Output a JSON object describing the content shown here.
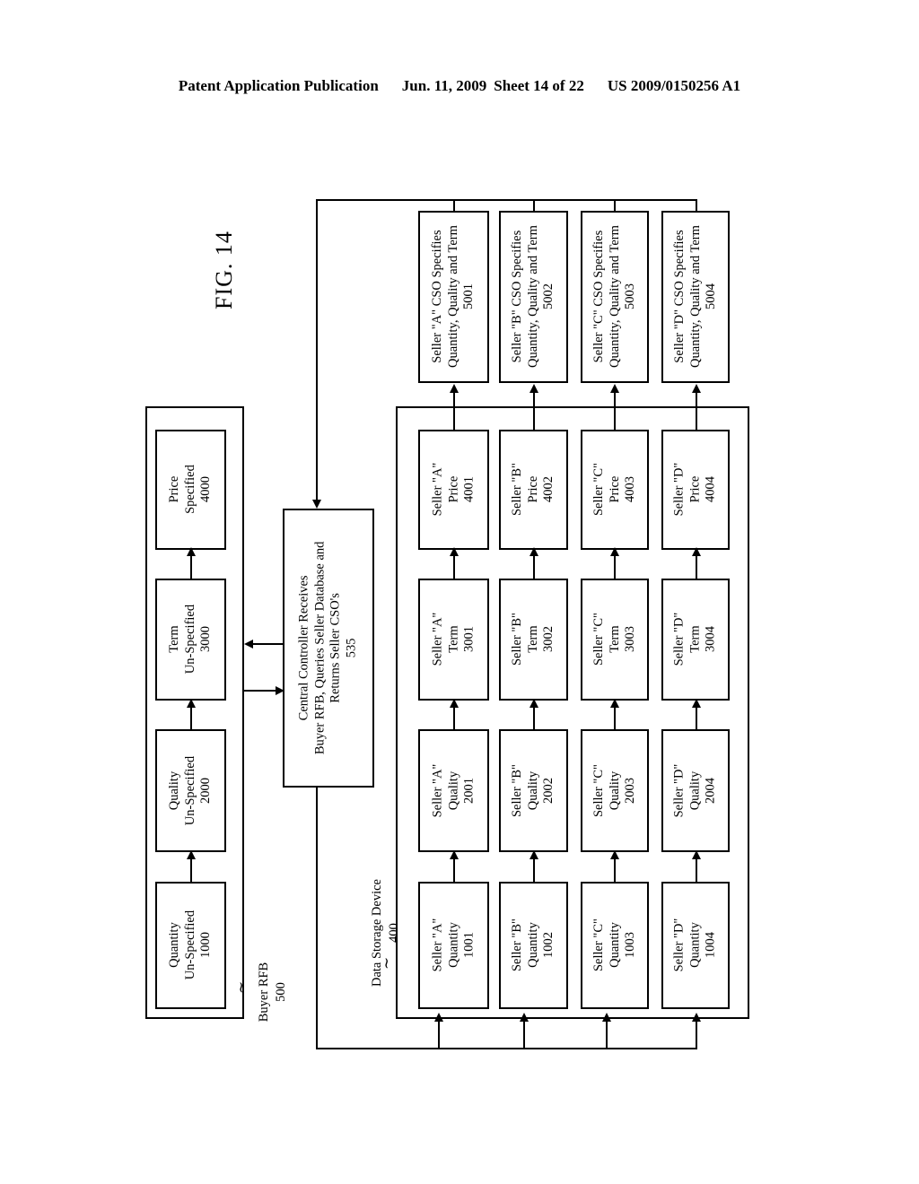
{
  "header": {
    "publication": "Patent Application Publication",
    "date": "Jun. 11, 2009",
    "sheet": "Sheet 14 of 22",
    "patent_number": "US 2009/0150256 A1"
  },
  "figure": {
    "title": "FIG. 14"
  },
  "buyer_rfb": {
    "label_line1": "Buyer RFB",
    "label_line2": "500",
    "squiggle": "∼",
    "boxes": [
      {
        "line1": "Quantity",
        "line2": "Un-Specified",
        "line3": "1000"
      },
      {
        "line1": "Quality",
        "line2": "Un-Specified",
        "line3": "2000"
      },
      {
        "line1": "Term",
        "line2": "Un-Specified",
        "line3": "3000"
      },
      {
        "line1": "Price",
        "line2": "Specified",
        "line3": "4000"
      }
    ]
  },
  "central_controller": {
    "line1": "Central Controller Receives",
    "line2": "Buyer RFB, Queries Seller Database and",
    "line3": "Returns Seller CSO's",
    "line4": "535"
  },
  "data_storage": {
    "label_line1": "Data Storage Device",
    "label_line2": "400",
    "squiggle": "∼"
  },
  "seller_cso": [
    {
      "line1": "Seller \"A\" CSO Specifies",
      "line2": "Quantity, Quality and Term",
      "line3": "5001"
    },
    {
      "line1": "Seller \"B\" CSO Specifies",
      "line2": "Quantity, Quality and Term",
      "line3": "5002"
    },
    {
      "line1": "Seller \"C\" CSO Specifies",
      "line2": "Quantity, Quality and Term",
      "line3": "5003"
    },
    {
      "line1": "Seller \"D\" CSO Specifies",
      "line2": "Quantity, Quality and Term",
      "line3": "5004"
    }
  ],
  "seller_grid": {
    "rows": [
      {
        "seller": "Seller \"A\"",
        "cells": [
          {
            "line1": "Seller \"A\"",
            "line2": "Quantity",
            "line3": "1001"
          },
          {
            "line1": "Seller \"A\"",
            "line2": "Quality",
            "line3": "2001"
          },
          {
            "line1": "Seller \"A\"",
            "line2": "Term",
            "line3": "3001"
          },
          {
            "line1": "Seller \"A\"",
            "line2": "Price",
            "line3": "4001"
          }
        ]
      },
      {
        "seller": "Seller \"B\"",
        "cells": [
          {
            "line1": "Seller \"B\"",
            "line2": "Quantity",
            "line3": "1002"
          },
          {
            "line1": "Seller \"B\"",
            "line2": "Quality",
            "line3": "2002"
          },
          {
            "line1": "Seller \"B\"",
            "line2": "Term",
            "line3": "3002"
          },
          {
            "line1": "Seller \"B\"",
            "line2": "Price",
            "line3": "4002"
          }
        ]
      },
      {
        "seller": "Seller \"C\"",
        "cells": [
          {
            "line1": "Seller \"C\"",
            "line2": "Quantity",
            "line3": "1003"
          },
          {
            "line1": "Seller \"C\"",
            "line2": "Quality",
            "line3": "2003"
          },
          {
            "line1": "Seller \"C\"",
            "line2": "Term",
            "line3": "3003"
          },
          {
            "line1": "Seller \"C\"",
            "line2": "Price",
            "line3": "4003"
          }
        ]
      },
      {
        "seller": "Seller \"D\"",
        "cells": [
          {
            "line1": "Seller \"D\"",
            "line2": "Quantity",
            "line3": "1004"
          },
          {
            "line1": "Seller \"D\"",
            "line2": "Quality",
            "line3": "2004"
          },
          {
            "line1": "Seller \"D\"",
            "line2": "Term",
            "line3": "3004"
          },
          {
            "line1": "Seller \"D\"",
            "line2": "Price",
            "line3": "4004"
          }
        ]
      }
    ]
  },
  "colors": {
    "ink": "#000000",
    "paper": "#ffffff"
  }
}
